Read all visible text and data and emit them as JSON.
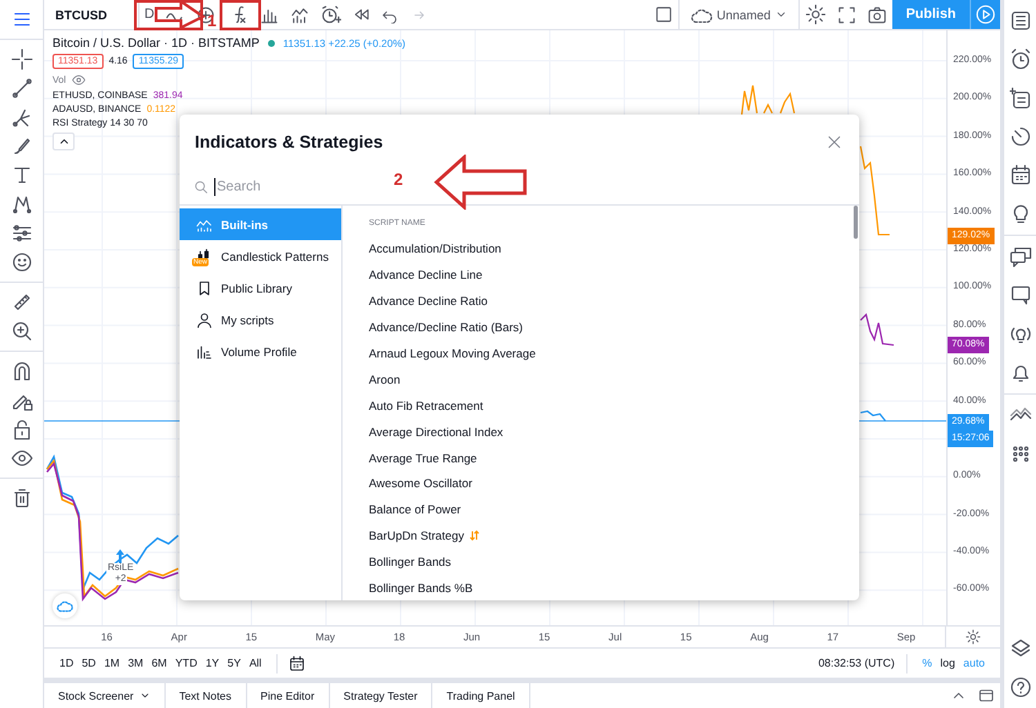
{
  "top_bar": {
    "symbol": "BTCUSD",
    "interval": "D",
    "layout_name": "Unnamed",
    "publish": "Publish"
  },
  "legend": {
    "title": "Bitcoin / U.S. Dollar · 1D · BITSTAMP",
    "quote": "11351.13 +22.25 (+0.20%)",
    "bid": "11351.13",
    "spread": "4.16",
    "ask": "11355.29",
    "volume": "Vol",
    "compare": [
      {
        "symbol": "ETHUSD, COINBASE",
        "value": "381.94",
        "color": "#9c27b0"
      },
      {
        "symbol": "ADAUSD, BINANCE",
        "value": "0.1122",
        "color": "#ff9800"
      }
    ],
    "strategy": "RSI Strategy 14 30 70"
  },
  "chart": {
    "price_axis": [
      "220.00%",
      "200.00%",
      "180.00%",
      "160.00%",
      "140.00%",
      "120.00%",
      "100.00%",
      "80.00%",
      "60.00%",
      "40.00%",
      "0.00%",
      "-20.00%",
      "-40.00%",
      "-60.00%"
    ],
    "price_badges": [
      {
        "label": "129.02%",
        "color": "#f57c00"
      },
      {
        "label": "70.08%",
        "color": "#9c27b0"
      },
      {
        "label": "29.68%",
        "color": "#2196f3"
      },
      {
        "label": "15:27:06",
        "color": "#2196f3"
      }
    ],
    "time_axis": [
      "16",
      "Apr",
      "15",
      "May",
      "18",
      "Jun",
      "15",
      "Jul",
      "15",
      "Aug",
      "17",
      "Sep"
    ],
    "signal": {
      "label": "RsiLE",
      "count": "+2"
    }
  },
  "range_bar": {
    "ranges": [
      "1D",
      "5D",
      "1M",
      "3M",
      "6M",
      "YTD",
      "1Y",
      "5Y",
      "All"
    ],
    "clock": "08:32:53 (UTC)",
    "toggles": [
      {
        "label": "%",
        "on": true
      },
      {
        "label": "log",
        "on": false
      },
      {
        "label": "auto",
        "on": true
      }
    ]
  },
  "bottom_tabs": [
    "Stock Screener",
    "Text Notes",
    "Pine Editor",
    "Strategy Tester",
    "Trading Panel"
  ],
  "dialog": {
    "title": "Indicators & Strategies",
    "search_placeholder": "Search",
    "categories": [
      {
        "label": "Built-ins",
        "selected": true
      },
      {
        "label": "Candlestick Patterns",
        "selected": false,
        "badge": "New"
      },
      {
        "label": "Public Library",
        "selected": false
      },
      {
        "label": "My scripts",
        "selected": false
      },
      {
        "label": "Volume Profile",
        "selected": false
      }
    ],
    "column_header": "SCRIPT NAME",
    "scripts": [
      {
        "name": "Accumulation/Distribution",
        "kind": "indicator"
      },
      {
        "name": "Advance Decline Line",
        "kind": "indicator"
      },
      {
        "name": "Advance Decline Ratio",
        "kind": "indicator"
      },
      {
        "name": "Advance/Decline Ratio (Bars)",
        "kind": "indicator"
      },
      {
        "name": "Arnaud Legoux Moving Average",
        "kind": "indicator"
      },
      {
        "name": "Aroon",
        "kind": "indicator"
      },
      {
        "name": "Auto Fib Retracement",
        "kind": "indicator"
      },
      {
        "name": "Average Directional Index",
        "kind": "indicator"
      },
      {
        "name": "Average True Range",
        "kind": "indicator"
      },
      {
        "name": "Awesome Oscillator",
        "kind": "indicator"
      },
      {
        "name": "Balance of Power",
        "kind": "indicator"
      },
      {
        "name": "BarUpDn Strategy",
        "kind": "strategy"
      },
      {
        "name": "Bollinger Bands",
        "kind": "indicator"
      },
      {
        "name": "Bollinger Bands %B",
        "kind": "indicator"
      }
    ]
  },
  "annotations": [
    {
      "label": "1"
    },
    {
      "label": "2"
    }
  ]
}
